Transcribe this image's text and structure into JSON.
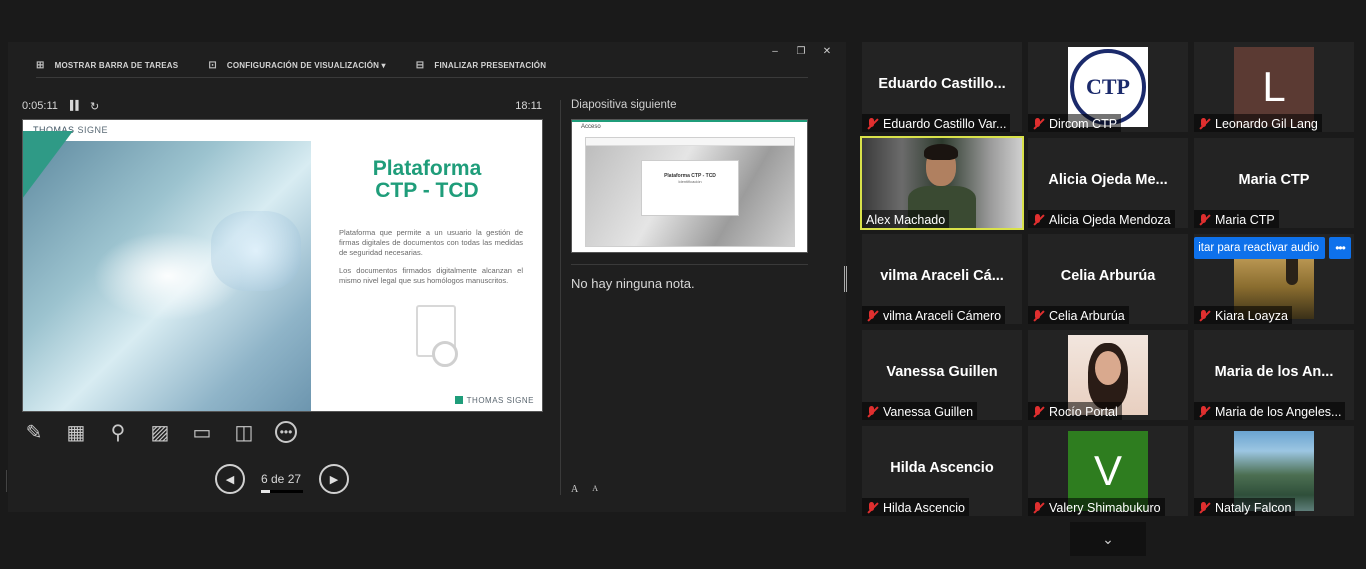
{
  "presenter": {
    "window_controls": {
      "minimize": "–",
      "restore": "❐",
      "close": "✕"
    },
    "toolbar": [
      {
        "icon": "taskbar-icon",
        "glyph": "⊞",
        "label": "MOSTRAR BARRA DE TAREAS"
      },
      {
        "icon": "display-settings-icon",
        "glyph": "⊡",
        "label": "CONFIGURACIÓN DE VISUALIZACIÓN ▾"
      },
      {
        "icon": "end-presentation-icon",
        "glyph": "⊟",
        "label": "FINALIZAR PRESENTACIÓN"
      }
    ],
    "elapsed": "0:05:11",
    "pause_glyph": "▌▌",
    "reset_glyph": "↻",
    "clock": "18:11",
    "current_slide": {
      "brand_a": "THOMAS",
      "brand_b": " SIGNE",
      "title_line1": "Plataforma",
      "title_line2": "CTP - TCD",
      "paragraph1": "Plataforma que permite a un usuario la gestión de firmas digitales de documentos con todas las medidas de seguridad necesarias.",
      "paragraph2": "Los documentos firmados digitalmente alcanzan el mismo nivel legal que sus homólogos manuscritos.",
      "logo": "THOMAS SIGNE"
    },
    "slide_tools": [
      {
        "icon": "pen-icon",
        "glyph": "✎"
      },
      {
        "icon": "slides-grid-icon",
        "glyph": "▦"
      },
      {
        "icon": "zoom-icon",
        "glyph": "⚲"
      },
      {
        "icon": "black-screen-icon",
        "glyph": "▨"
      },
      {
        "icon": "subtitles-icon",
        "glyph": "▭"
      },
      {
        "icon": "camera-off-icon",
        "glyph": "◫"
      },
      {
        "icon": "more-options-icon",
        "glyph": "•••"
      }
    ],
    "nav": {
      "prev": "◀",
      "next": "▶",
      "page": "6 de 27",
      "progress": 0.22
    },
    "next_label": "Diapositiva siguiente",
    "next_slide": {
      "header": "Acceso",
      "card_title": "Plataforma CTP - TCD",
      "card_sub": "Identificación"
    },
    "notes": "No hay ninguna nota.",
    "font_up": "A",
    "font_down": "A"
  },
  "gallery": {
    "tiles": [
      {
        "big": "Eduardo  Castillo...",
        "label": "Eduardo Castillo Var...",
        "avatar": "none"
      },
      {
        "big": "",
        "label": "Dircom CTP",
        "avatar": "seal",
        "seal_text": "CTP"
      },
      {
        "big": "",
        "label": "Leonardo Gil Lang",
        "avatar": "letter",
        "letter": "L",
        "color": "#5b3a33"
      },
      {
        "big": "",
        "label": "Alex Machado",
        "avatar": "video"
      },
      {
        "big": "Alicia  Ojeda  Me...",
        "label": "Alicia Ojeda Mendoza",
        "avatar": "none"
      },
      {
        "big": "Maria CTP",
        "label": "Maria CTP",
        "avatar": "none"
      },
      {
        "big": "vilma  Araceli  Cá...",
        "label": "vilma Araceli Cámero",
        "avatar": "none"
      },
      {
        "big": "Celia Arburúa",
        "label": "Celia Arburúa",
        "avatar": "none"
      },
      {
        "big": "",
        "label": "Kiara Loayza",
        "avatar": "photo-kiara"
      },
      {
        "big": "Vanessa Guillen",
        "label": "Vanessa Guillen",
        "avatar": "none"
      },
      {
        "big": "",
        "label": "Rocío Portal",
        "avatar": "photo-woman"
      },
      {
        "big": "Maria de los An...",
        "label": "Maria de los Angeles...",
        "avatar": "none"
      },
      {
        "big": "Hilda Ascencio",
        "label": "Hilda Ascencio",
        "avatar": "none"
      },
      {
        "big": "",
        "label": "Valery Shimabukuro",
        "avatar": "letter",
        "letter": "V",
        "color": "#2e7d1f"
      },
      {
        "big": "",
        "label": "Nataly Falcon",
        "avatar": "photo-mount"
      }
    ],
    "unmute_banner": "itar para reactivar audio",
    "more_glyph": "•••",
    "pager_glyph": "⌄"
  },
  "colors": {
    "accent_teal": "#1f9d7a",
    "active_speaker": "#d9e24a",
    "zoom_blue": "#0e71eb",
    "muted_red": "#e02f2f"
  }
}
